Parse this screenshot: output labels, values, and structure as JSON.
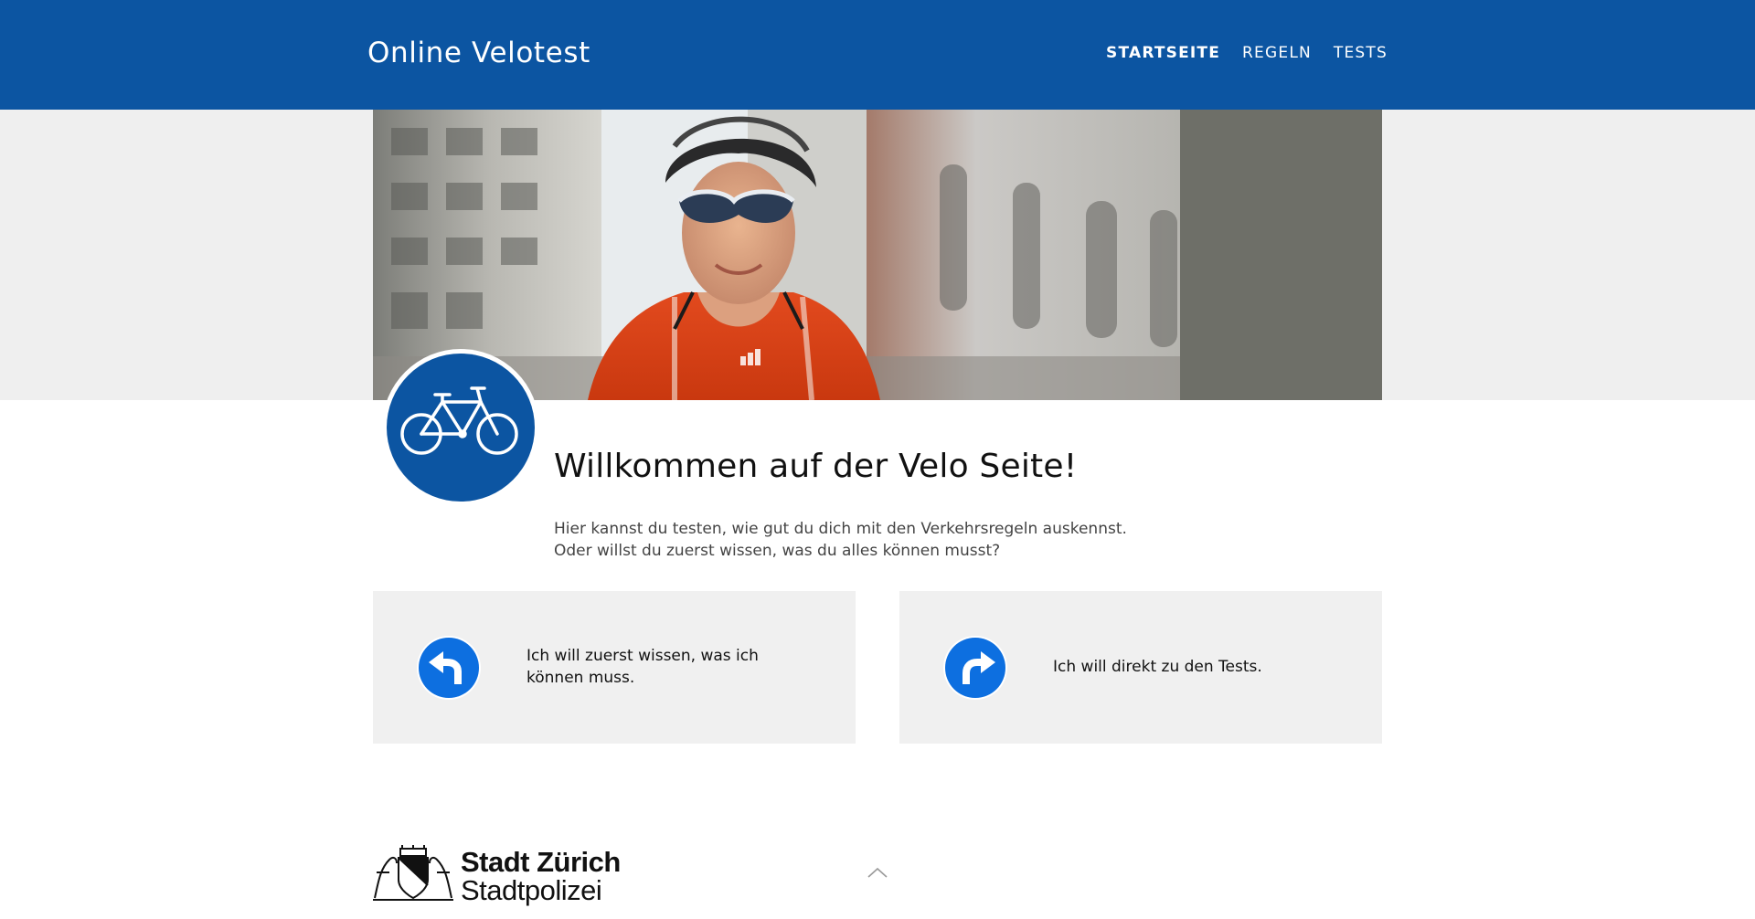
{
  "header": {
    "title": "Online Velotest",
    "nav": [
      {
        "label": "STARTSEITE",
        "active": true
      },
      {
        "label": "REGELN",
        "active": false
      },
      {
        "label": "TESTS",
        "active": false
      }
    ]
  },
  "hero": {
    "image": "cyclist-with-helmet-and-sunglasses-photo",
    "badge_icon": "bicycle-sign-icon"
  },
  "welcome": {
    "title": "Willkommen auf der Velo Seite!",
    "line1": "Hier kannst du testen, wie gut du dich mit den Verkehrsregeln auskennst.",
    "line2": "Oder willst du zuerst wissen, was du alles können musst?"
  },
  "cards": {
    "left": {
      "icon": "turn-left-arrow-icon",
      "text": "Ich will zuerst wissen, was ich können muss."
    },
    "right": {
      "icon": "turn-right-arrow-icon",
      "text": "Ich will direkt zu den Tests."
    }
  },
  "footer": {
    "logo_line1": "Stadt Zürich",
    "logo_line2": "Stadtpolizei",
    "to_top_icon": "chevron-up-icon"
  },
  "colors": {
    "brand_blue": "#0c55a2",
    "sign_blue": "#0d6fe0",
    "light_gray": "#efefef",
    "hero_gray": "#6e6f68"
  }
}
